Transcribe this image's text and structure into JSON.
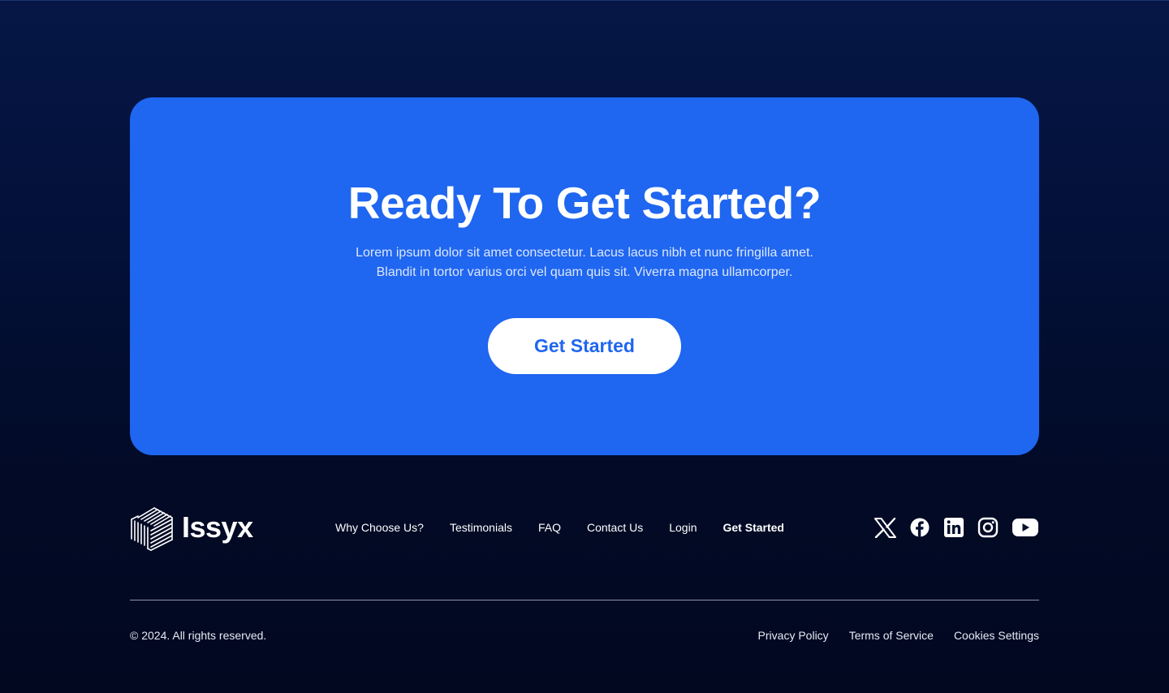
{
  "cta": {
    "title": "Ready To Get Started?",
    "description_line1": "Lorem ipsum dolor sit amet consectetur. Lacus lacus nibh et nunc fringilla amet.",
    "description_line2": "Blandit in tortor varius orci vel quam quis sit. Viverra magna ullamcorper.",
    "button_label": "Get Started"
  },
  "footer": {
    "brand": {
      "name": "Issyx",
      "icon": "stacked-lines-cube-logo"
    },
    "nav": [
      {
        "label": "Why Choose Us?"
      },
      {
        "label": "Testimonials"
      },
      {
        "label": "FAQ"
      },
      {
        "label": "Contact Us"
      },
      {
        "label": "Login"
      },
      {
        "label": "Get Started"
      }
    ],
    "socials": [
      {
        "icon": "x-icon"
      },
      {
        "icon": "facebook-icon"
      },
      {
        "icon": "linkedin-icon"
      },
      {
        "icon": "instagram-icon"
      },
      {
        "icon": "youtube-icon"
      }
    ],
    "copyright": "© 2024. All rights reserved.",
    "legal": [
      {
        "label": "Privacy Policy"
      },
      {
        "label": "Terms of Service"
      },
      {
        "label": "Cookies Settings"
      }
    ]
  },
  "colors": {
    "background_top": "#061746",
    "background_bottom": "#020820",
    "accent": "#1f66f0",
    "button_bg": "#ffffff",
    "text": "#ffffff"
  }
}
